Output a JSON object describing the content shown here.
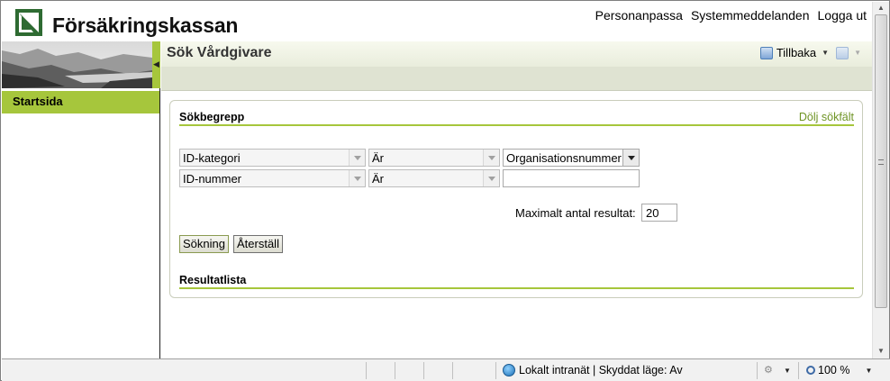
{
  "header": {
    "logo_text": "Försäkringskassan",
    "nav": [
      "Personanpassa",
      "Systemmeddelanden",
      "Logga ut"
    ]
  },
  "sidebar": {
    "items": [
      {
        "label": "Startsida"
      }
    ]
  },
  "page": {
    "title": "Sök Vårdgivare",
    "back_label": "Tillbaka"
  },
  "search": {
    "section_title": "Sökbegrepp",
    "hide_link": "Dölj sökfält",
    "row1": {
      "field": "ID-kategori",
      "operator": "Är",
      "value": "Organisationsnummer"
    },
    "row2": {
      "field": "ID-nummer",
      "operator": "Är",
      "value": ""
    },
    "max_results_label": "Maximalt antal resultat:",
    "max_results_value": "20",
    "search_button": "Sökning",
    "reset_button": "Återställ",
    "results_title": "Resultatlista"
  },
  "statusbar": {
    "zone_text": "Lokalt intranät | Skyddat läge: Av",
    "zoom": "100 %"
  },
  "icons": {
    "logo": "forsakringskassan-logo-icon",
    "back": "back-arrow-icon",
    "forward": "forward-arrow-icon",
    "zone": "globe-icon",
    "zoom": "magnifier-icon"
  },
  "colors": {
    "accent_green": "#a6c63c",
    "logo_green": "#2e6b32",
    "link_green": "#6e9424"
  }
}
